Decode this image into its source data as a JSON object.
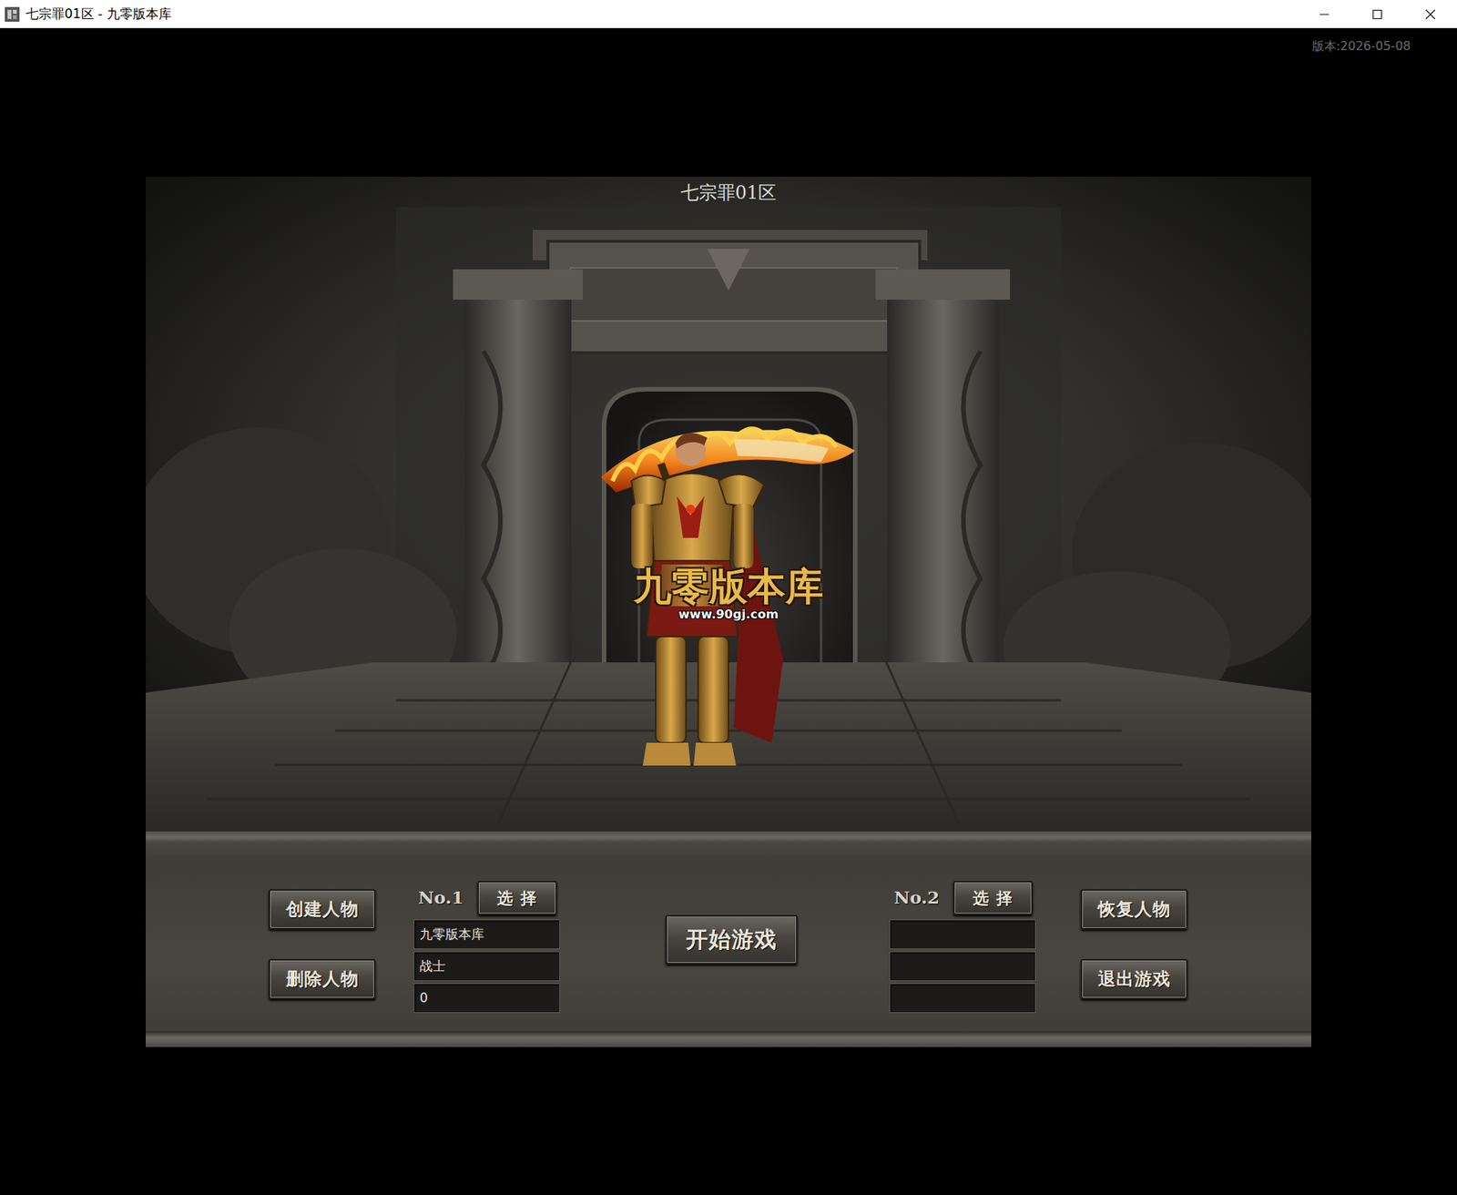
{
  "window": {
    "title": "七宗罪01区 - 九零版本库"
  },
  "version": "版本:2026-05-08",
  "server_title": "七宗罪01区",
  "watermark": {
    "name": "九零版本库",
    "url": "www.90gj.com"
  },
  "left_buttons": [
    "创建人物",
    "删除人物"
  ],
  "start_button": "开始游戏",
  "right_buttons": [
    "恢复人物",
    "退出游戏"
  ],
  "slots": [
    {
      "label": "No.1",
      "select": "选 择",
      "fields": [
        "九零版本库",
        "战士",
        "0"
      ]
    },
    {
      "label": "No.2",
      "select": "选 择",
      "fields": [
        "",
        "",
        ""
      ]
    }
  ]
}
